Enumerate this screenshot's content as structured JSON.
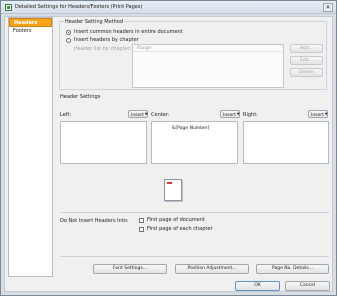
{
  "window": {
    "title": "Detailed Settings for Headers/Footers (Print Pages)",
    "close_glyph": "✕"
  },
  "nav": {
    "items": [
      {
        "label": "Headers",
        "selected": true
      },
      {
        "label": "Footers",
        "selected": false
      }
    ]
  },
  "header_setting_method": {
    "title": "Header Setting Method",
    "option_common": "Insert common headers in entire document",
    "option_by_chapter": "Insert headers by chapter",
    "selected": "common",
    "header_list_label": "Header list by chapter:",
    "list_column": "Range",
    "add_button": "Add...",
    "edit_button": "Edit...",
    "delete_button": "Delete"
  },
  "header_settings": {
    "title": "Header Settings",
    "left_label": "Left:",
    "center_label": "Center:",
    "right_label": "Right:",
    "insert_label": "Insert",
    "caret": "▼",
    "left_value": "",
    "center_value": "&[Page Number]",
    "right_value": ""
  },
  "do_not_insert": {
    "label": "Do Not Insert Headers Into:",
    "first_page_document": "First page of document",
    "first_page_chapter": "First page of each chapter",
    "first_page_document_checked": false,
    "first_page_chapter_checked": false
  },
  "buttons": {
    "font_settings": "Font Settings...",
    "position_adjustment": "Position Adjustment...",
    "page_no_details": "Page No. Details...",
    "ok": "OK",
    "cancel": "Cancel"
  },
  "colors": {
    "accent": "#f7a21b",
    "preview_header_mark": "#e0382b"
  }
}
